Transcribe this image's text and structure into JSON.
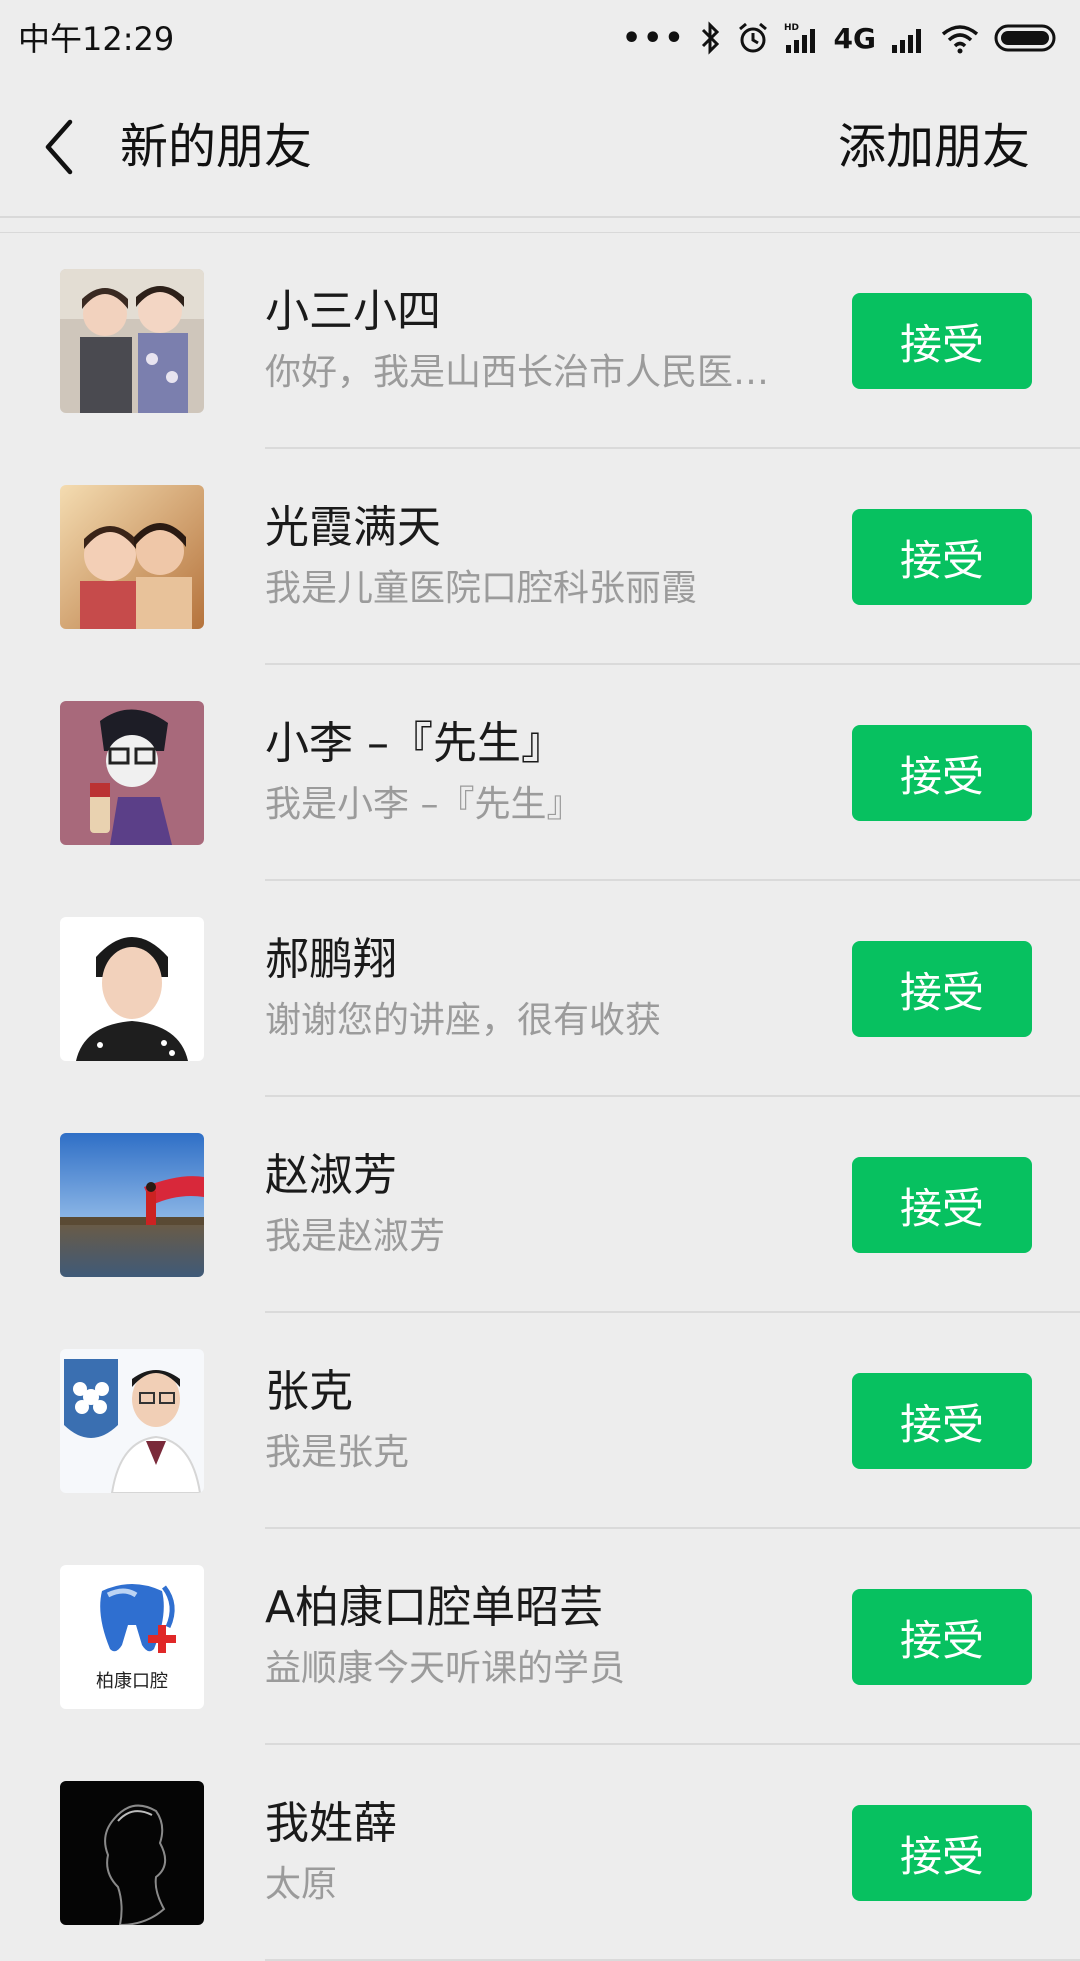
{
  "status_bar": {
    "time": "中午12:29",
    "dots": "•••",
    "network": "4G"
  },
  "header": {
    "title": "新的朋友",
    "add_friend": "添加朋友"
  },
  "accept_label": "接受",
  "requests": [
    {
      "name": "小三小四",
      "message": "你好，我是山西长治市人民医…"
    },
    {
      "name": "光霞满天",
      "message": "我是儿童医院口腔科张丽霞"
    },
    {
      "name": "小李 –『先生』",
      "message": "我是小李 –『先生』"
    },
    {
      "name": "郝鹏翔",
      "message": "谢谢您的讲座，很有收获"
    },
    {
      "name": "赵淑芳",
      "message": "我是赵淑芳"
    },
    {
      "name": "张克",
      "message": "我是张克"
    },
    {
      "name": "A柏康口腔单昭芸",
      "message": "益顺康今天听课的学员",
      "avatar_text": "柏康口腔"
    },
    {
      "name": "我姓薛",
      "message": "太原"
    }
  ],
  "colors": {
    "accent": "#07c160",
    "background": "#ededed"
  }
}
